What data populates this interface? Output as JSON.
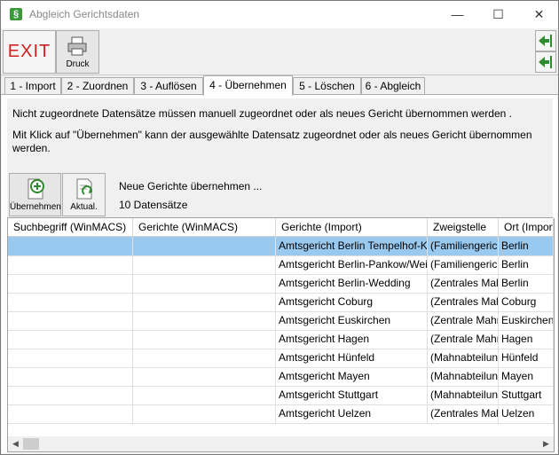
{
  "window": {
    "title": "Abgleich Gerichtsdaten"
  },
  "toolbar": {
    "exit_label": "EXIT",
    "print_label": "Druck"
  },
  "tabs": [
    {
      "label": "1 - Import"
    },
    {
      "label": "2 - Zuordnen"
    },
    {
      "label": "3 - Auflösen"
    },
    {
      "label": "4 - Übernehmen"
    },
    {
      "label": "5 - Löschen"
    },
    {
      "label": "6 - Abgleich"
    }
  ],
  "info": {
    "line1": "Nicht zugeordnete Datensätze müssen manuell zugeordnet oder als neues Gericht übernommen werden .",
    "line2": "Mit Klick auf \"Übernehmen\" kann der ausgewählte Datensatz zugeordnet oder als neues Gericht übernommen werden."
  },
  "actions": {
    "accept_label": "Übernehmen",
    "refresh_label": "Aktual.",
    "title": "Neue Gerichte übernehmen ...",
    "count": "10 Datensätze"
  },
  "grid": {
    "columns": [
      "Suchbegriff (WinMACS)",
      "Gerichte (WinMACS)",
      "Gerichte (Import)",
      "Zweigstelle",
      "Ort (Import)"
    ],
    "rows": [
      {
        "suchbegriff": "",
        "gericht_winmacs": "",
        "gericht_import": "Amtsgericht Berlin Tempelhof-Kreuzberg",
        "zweigstelle": "(Familiengericht)",
        "ort": "Berlin"
      },
      {
        "suchbegriff": "",
        "gericht_winmacs": "",
        "gericht_import": "Amtsgericht Berlin-Pankow/Weißensee",
        "zweigstelle": "(Familiengericht)",
        "ort": "Berlin"
      },
      {
        "suchbegriff": "",
        "gericht_winmacs": "",
        "gericht_import": "Amtsgericht Berlin-Wedding",
        "zweigstelle": "(Zentrales Mahngericht)",
        "ort": "Berlin"
      },
      {
        "suchbegriff": "",
        "gericht_winmacs": "",
        "gericht_import": "Amtsgericht Coburg",
        "zweigstelle": "(Zentrales Mahngericht)",
        "ort": "Coburg"
      },
      {
        "suchbegriff": "",
        "gericht_winmacs": "",
        "gericht_import": "Amtsgericht Euskirchen",
        "zweigstelle": "(Zentrale Mahnabteilung)",
        "ort": "Euskirchen"
      },
      {
        "suchbegriff": "",
        "gericht_winmacs": "",
        "gericht_import": "Amtsgericht Hagen",
        "zweigstelle": "(Zentrale Mahnabteilung)",
        "ort": "Hagen"
      },
      {
        "suchbegriff": "",
        "gericht_winmacs": "",
        "gericht_import": "Amtsgericht Hünfeld",
        "zweigstelle": "(Mahnabteilung)",
        "ort": "Hünfeld"
      },
      {
        "suchbegriff": "",
        "gericht_winmacs": "",
        "gericht_import": "Amtsgericht Mayen",
        "zweigstelle": "(Mahnabteilung)",
        "ort": "Mayen"
      },
      {
        "suchbegriff": "",
        "gericht_winmacs": "",
        "gericht_import": "Amtsgericht Stuttgart",
        "zweigstelle": "(Mahnabteilung)",
        "ort": "Stuttgart"
      },
      {
        "suchbegriff": "",
        "gericht_winmacs": "",
        "gericht_import": "Amtsgericht Uelzen",
        "zweigstelle": "(Zentrales Mahngericht)",
        "ort": "Uelzen"
      }
    ]
  },
  "colors": {
    "selection": "#99c9ef",
    "exit_text": "#d21f1f",
    "accent_green": "#3a9b3a"
  }
}
